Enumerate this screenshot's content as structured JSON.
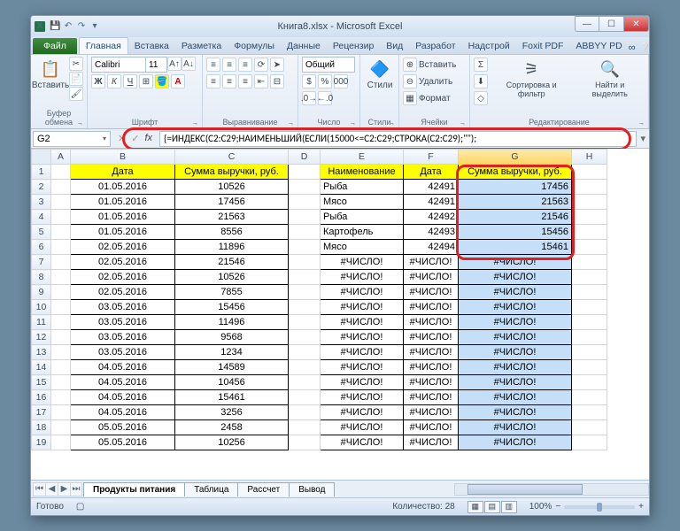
{
  "title": "Книга8.xlsx  -  Microsoft Excel",
  "tabs": {
    "file": "Файл",
    "items": [
      "Главная",
      "Вставка",
      "Разметка",
      "Формулы",
      "Данные",
      "Рецензир",
      "Вид",
      "Разработ",
      "Надстрой",
      "Foxit PDF",
      "ABBYY PD"
    ]
  },
  "ribbon": {
    "paste": "Вставить",
    "groups": [
      "Буфер обмена",
      "Шрифт",
      "Выравнивание",
      "Число",
      "Стили",
      "Ячейки",
      "Редактирование"
    ],
    "font_name": "Calibri",
    "font_size": "11",
    "num_format": "Общий",
    "styles": "Стили",
    "cell_cmds": [
      "Вставить",
      "Удалить",
      "Формат"
    ],
    "sort": "Сортировка и фильтр",
    "find": "Найти и выделить"
  },
  "namebox": "G2",
  "formula": "{=ИНДЕКС(C2:C29;НАИМЕНЬШИЙ(ЕСЛИ(15000<=C2:C29;СТРОКА(C2:C29);\"\");",
  "cols": [
    "A",
    "B",
    "C",
    "D",
    "E",
    "F",
    "G",
    "H"
  ],
  "hdr": {
    "B": "Дата",
    "C": "Сумма выручки, руб.",
    "E": "Наименование",
    "F": "Дата",
    "G": "Сумма выручки, руб."
  },
  "err": "#ЧИСЛО!",
  "rows": [
    {
      "n": 2,
      "B": "01.05.2016",
      "C": "10526",
      "E": "Рыба",
      "F": "42491",
      "G": "17456"
    },
    {
      "n": 3,
      "B": "01.05.2016",
      "C": "17456",
      "E": "Мясо",
      "F": "42491",
      "G": "21563"
    },
    {
      "n": 4,
      "B": "01.05.2016",
      "C": "21563",
      "E": "Рыба",
      "F": "42492",
      "G": "21546"
    },
    {
      "n": 5,
      "B": "01.05.2016",
      "C": "8556",
      "E": "Картофель",
      "F": "42493",
      "G": "15456"
    },
    {
      "n": 6,
      "B": "02.05.2016",
      "C": "11896",
      "E": "Мясо",
      "F": "42494",
      "G": "15461"
    },
    {
      "n": 7,
      "B": "02.05.2016",
      "C": "21546"
    },
    {
      "n": 8,
      "B": "02.05.2016",
      "C": "10526"
    },
    {
      "n": 9,
      "B": "02.05.2016",
      "C": "7855"
    },
    {
      "n": 10,
      "B": "03.05.2016",
      "C": "15456"
    },
    {
      "n": 11,
      "B": "03.05.2016",
      "C": "11496"
    },
    {
      "n": 12,
      "B": "03.05.2016",
      "C": "9568"
    },
    {
      "n": 13,
      "B": "03.05.2016",
      "C": "1234"
    },
    {
      "n": 14,
      "B": "04.05.2016",
      "C": "14589"
    },
    {
      "n": 15,
      "B": "04.05.2016",
      "C": "10456"
    },
    {
      "n": 16,
      "B": "04.05.2016",
      "C": "15461"
    },
    {
      "n": 17,
      "B": "04.05.2016",
      "C": "3256"
    },
    {
      "n": 18,
      "B": "05.05.2016",
      "C": "2458"
    },
    {
      "n": 19,
      "B": "05.05.2016",
      "C": "10256"
    }
  ],
  "sheet_tabs": [
    "Продукты питания",
    "Таблица",
    "Рассчет",
    "Вывод"
  ],
  "status": {
    "ready": "Готово",
    "count_lbl": "Количество:",
    "count": "28",
    "zoom": "100%"
  }
}
